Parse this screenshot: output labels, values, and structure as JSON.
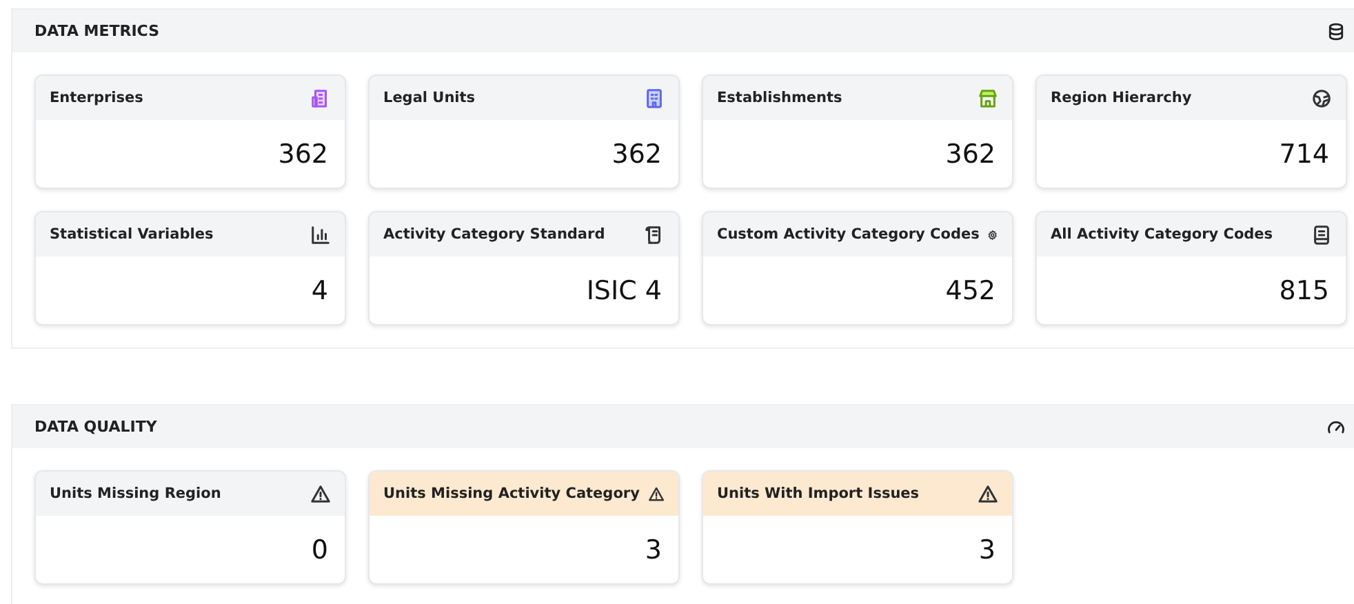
{
  "sections": [
    {
      "title": "DATA METRICS",
      "cards": [
        {
          "label": "Enterprises",
          "value": "362",
          "highlighted": false
        },
        {
          "label": "Legal Units",
          "value": "362",
          "highlighted": false
        },
        {
          "label": "Establishments",
          "value": "362",
          "highlighted": false
        },
        {
          "label": "Region Hierarchy",
          "value": "714",
          "highlighted": false
        },
        {
          "label": "Statistical Variables",
          "value": "4",
          "highlighted": false
        },
        {
          "label": "Activity Category Standard",
          "value": "ISIC 4",
          "highlighted": false
        },
        {
          "label": "Custom Activity Category Codes",
          "value": "452",
          "highlighted": false
        },
        {
          "label": "All Activity Category Codes",
          "value": "815",
          "highlighted": false
        }
      ]
    },
    {
      "title": "DATA QUALITY",
      "cards": [
        {
          "label": "Units Missing Region",
          "value": "0",
          "highlighted": false
        },
        {
          "label": "Units Missing Activity Category",
          "value": "3",
          "highlighted": true
        },
        {
          "label": "Units With Import Issues",
          "value": "3",
          "highlighted": true
        }
      ]
    }
  ]
}
